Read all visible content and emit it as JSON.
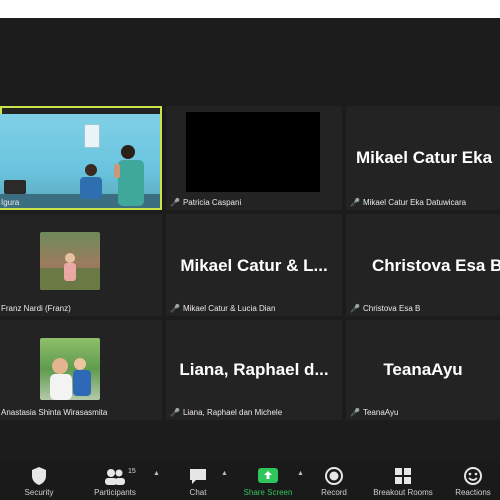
{
  "tiles": [
    {
      "label": "Igura",
      "type": "video"
    },
    {
      "label": "Patricia Caspani",
      "type": "blank"
    },
    {
      "big": "Mikael Catur Eka",
      "label": "Mikael Catur Eka Datuwicara"
    },
    {
      "label": "Franz Nardi (Franz)",
      "type": "photo"
    },
    {
      "big": "Mikael Catur & L...",
      "label": "Mikael Catur & Lucia Dian"
    },
    {
      "big": "Christova Esa B",
      "label": "Christova Esa B"
    },
    {
      "label": "Anastasia Shinta Wirasasmita",
      "type": "photo"
    },
    {
      "big": "Liana, Raphael d...",
      "label": "Liana, Raphael dan Michele"
    },
    {
      "big": "TeanaAyu",
      "label": "TeanaAyu"
    }
  ],
  "toolbar": {
    "security": "Security",
    "participants": "Participants",
    "participants_count": "15",
    "chat": "Chat",
    "share": "Share Screen",
    "record": "Record",
    "breakout": "Breakout Rooms",
    "reactions": "Reactions"
  },
  "colors": {
    "active_outline": "#c9e34a",
    "share_green": "#2ec55a",
    "muted_red": "#e04545"
  }
}
